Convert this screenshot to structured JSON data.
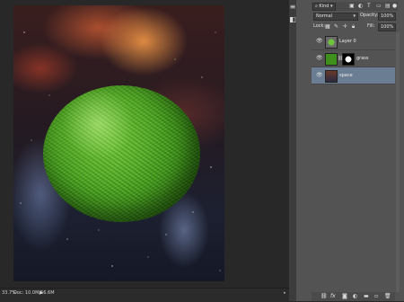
{
  "layers_panel": {
    "filter": {
      "kind_label": "Kind"
    },
    "blend_mode": "Normal",
    "opacity_label": "Opacity:",
    "opacity_value": "100%",
    "lock_label": "Lock:",
    "fill_label": "Fill:",
    "fill_value": "100%",
    "layers": [
      {
        "name": "Layer 0",
        "visible": true,
        "selected": false
      },
      {
        "name": "grass",
        "visible": true,
        "selected": false
      },
      {
        "name": "space",
        "visible": true,
        "selected": true
      }
    ]
  },
  "status_bar": {
    "zoom": "33.7%",
    "doc_info": "Doc: 10.0M/56.6M"
  },
  "icons": {
    "eye": "eye-icon",
    "lock": "lock-icon",
    "link": "link-icon",
    "fx": "fx-icon",
    "mask": "mask-icon",
    "adjustment": "adjustment-icon",
    "folder": "folder-icon",
    "new_layer": "new-layer-icon",
    "trash": "trash-icon"
  },
  "colors": {
    "selected_row": "#6a7d92",
    "panel_bg": "#535353",
    "workspace_bg": "#282828"
  }
}
